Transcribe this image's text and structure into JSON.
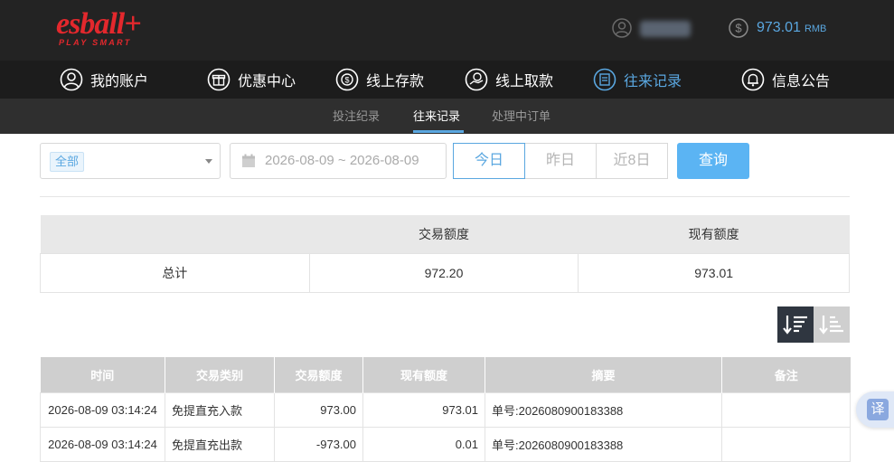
{
  "brand": {
    "logo": "esball+",
    "tagline": "PLAY SMART",
    "color": "#e3282d"
  },
  "account": {
    "balance": "973.01",
    "currency": "RMB"
  },
  "main_nav": [
    {
      "label": "我的账户",
      "icon": "user-circle-icon"
    },
    {
      "label": "优惠中心",
      "icon": "gift-icon"
    },
    {
      "label": "线上存款",
      "icon": "deposit-icon"
    },
    {
      "label": "线上取款",
      "icon": "withdraw-icon"
    },
    {
      "label": "往来记录",
      "icon": "records-icon",
      "active": true
    },
    {
      "label": "信息公告",
      "icon": "bell-icon"
    }
  ],
  "sub_nav": [
    {
      "label": "投注纪录"
    },
    {
      "label": "往来记录",
      "active": true
    },
    {
      "label": "处理中订单"
    }
  ],
  "filters": {
    "type_selected": "全部",
    "date_range": "2026-08-09 ~ 2026-08-09",
    "quick_ranges": [
      "今日",
      "昨日",
      "近8日"
    ],
    "active_range": "今日",
    "query_label": "查询"
  },
  "summary": {
    "headers": [
      "",
      "交易额度",
      "现有额度"
    ],
    "row": [
      "总计",
      "972.20",
      "973.01"
    ]
  },
  "records": {
    "headers": [
      "时间",
      "交易类别",
      "交易额度",
      "现有额度",
      "摘要",
      "备注"
    ],
    "rows": [
      [
        "2026-08-09 03:14:24",
        "免提直充入款",
        "973.00",
        "973.01",
        "单号:2026080900183388",
        ""
      ],
      [
        "2026-08-09 03:14:24",
        "免提直充出款",
        "-973.00",
        "0.01",
        "单号:2026080900183388",
        ""
      ]
    ]
  },
  "translate_label": "译",
  "colors": {
    "accent": "#5aa7e0",
    "button": "#5bb4f3",
    "header_bg": "#232323"
  }
}
